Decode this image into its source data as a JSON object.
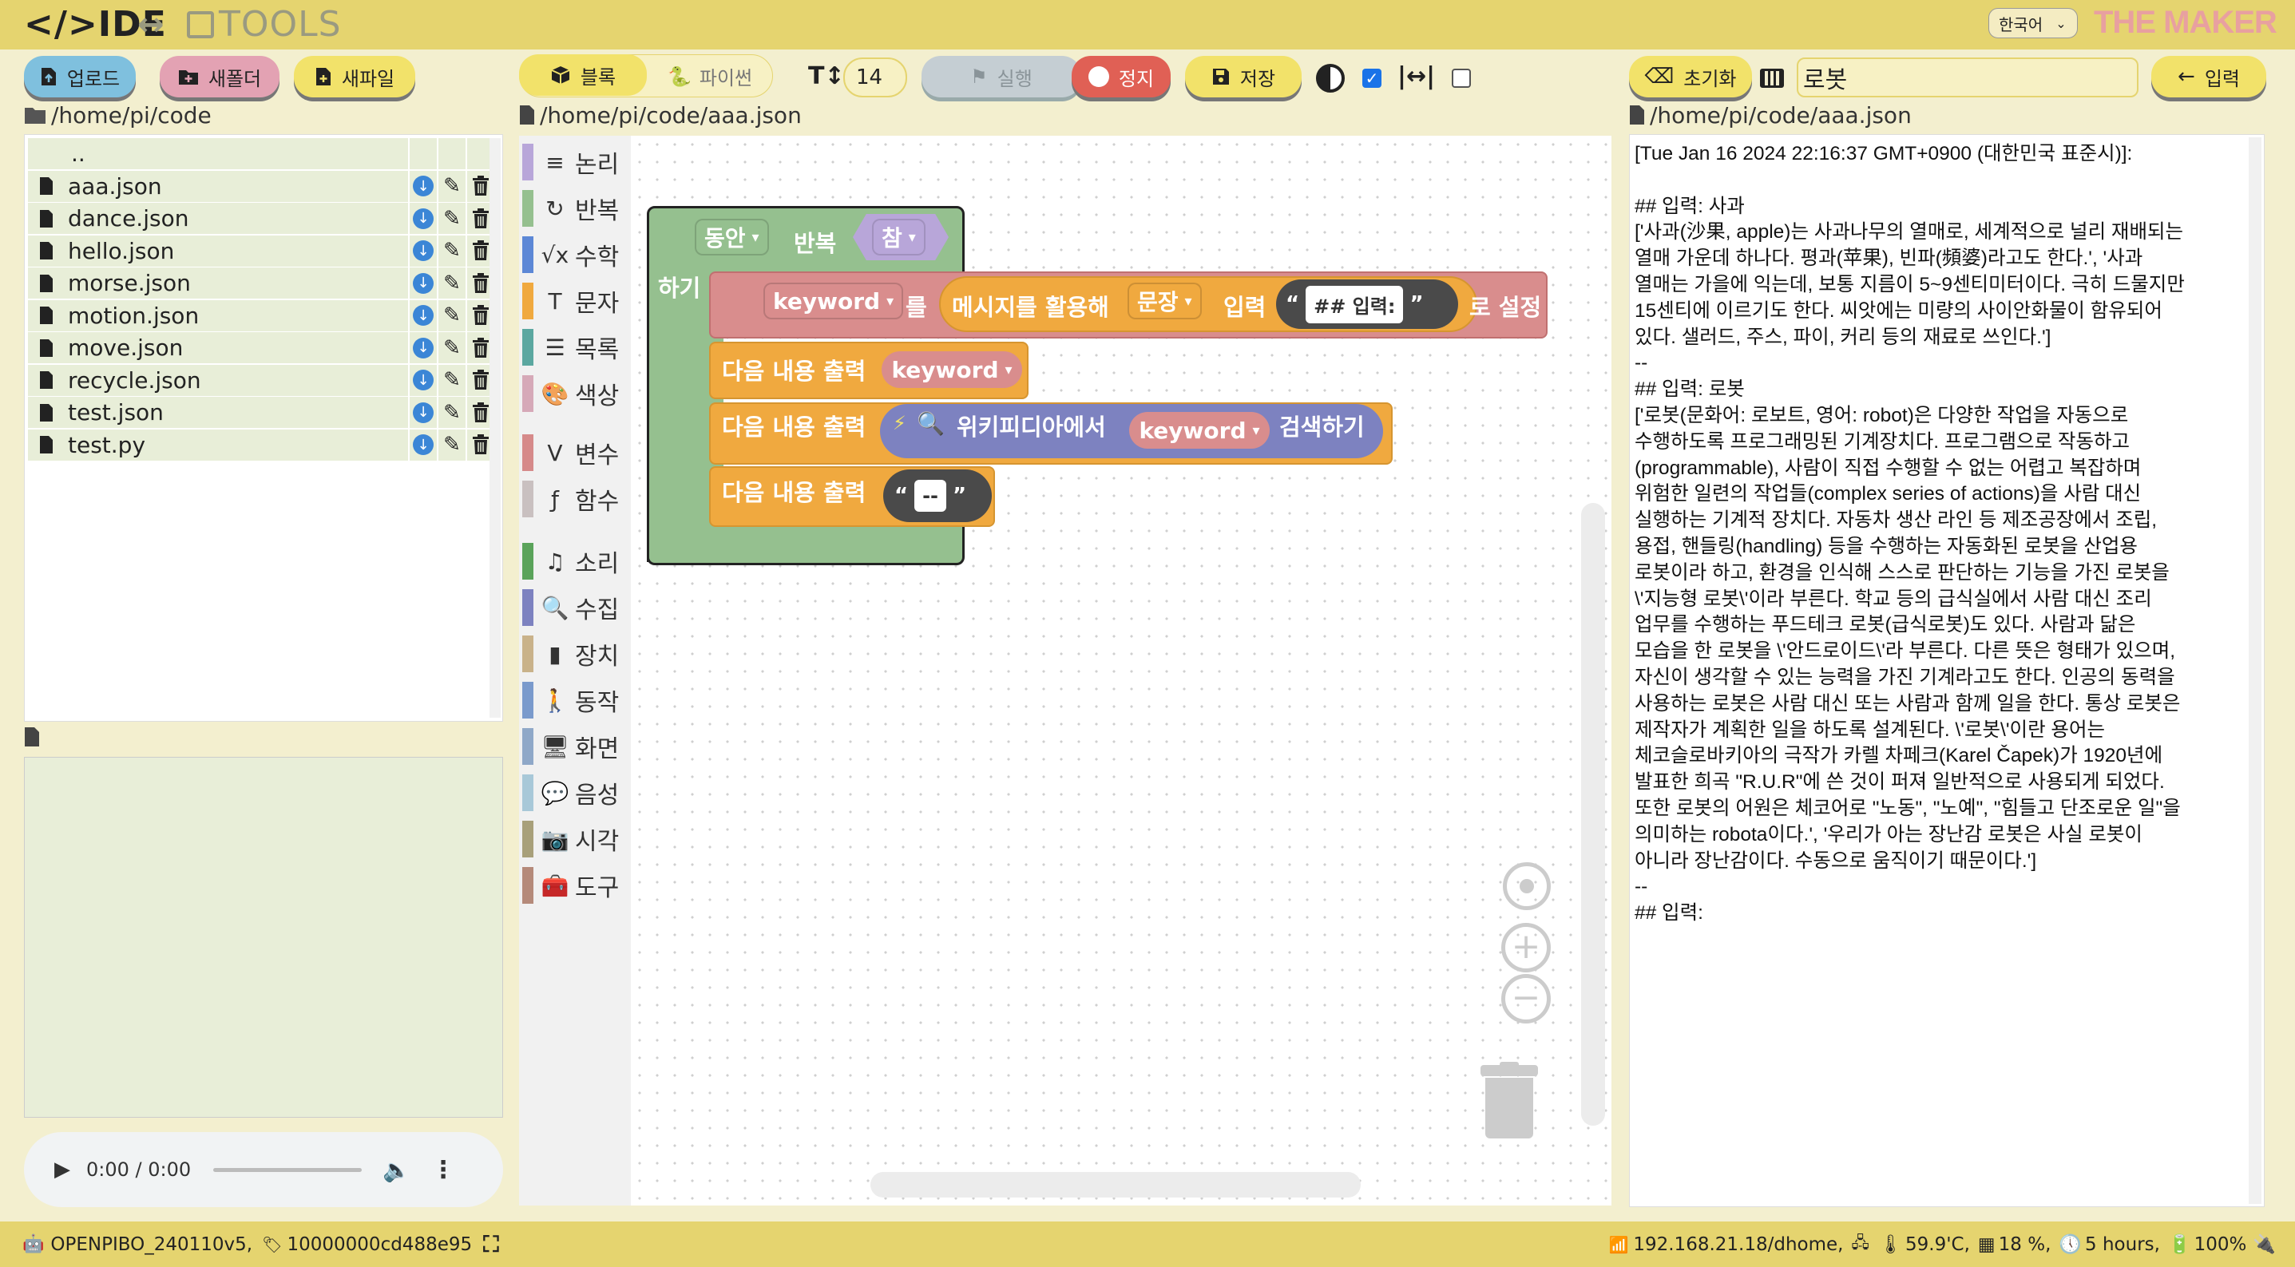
{
  "header": {
    "logo_ide": "</>IDE",
    "logo_arrow": "↔",
    "logo_tools": "TOOLS",
    "language": "한국어",
    "brand": "THE MAKER"
  },
  "left": {
    "buttons": {
      "upload": "업로드",
      "new_folder": "새폴더",
      "new_file": "새파일"
    },
    "path": "/home/pi/code",
    "files": [
      {
        "name": ".."
      },
      {
        "name": "aaa.json"
      },
      {
        "name": "dance.json"
      },
      {
        "name": "hello.json"
      },
      {
        "name": "morse.json"
      },
      {
        "name": "motion.json"
      },
      {
        "name": "move.json"
      },
      {
        "name": "recycle.json"
      },
      {
        "name": "test.json"
      },
      {
        "name": "test.py"
      }
    ],
    "audio_time": "0:00 / 0:00"
  },
  "editor": {
    "tab_block": "블록",
    "tab_python": "파이썬",
    "font_size": "14",
    "run": "실행",
    "stop": "정지",
    "save": "저장",
    "path": "/home/pi/code/aaa.json",
    "categories": [
      {
        "label": "논리",
        "color": "#b8a6d9",
        "icon": "≡"
      },
      {
        "label": "반복",
        "color": "#95c08f",
        "icon": "↻"
      },
      {
        "label": "수학",
        "color": "#5c87d6",
        "icon": "√x"
      },
      {
        "label": "문자",
        "color": "#f0a93f",
        "icon": "T"
      },
      {
        "label": "목록",
        "color": "#5ba7a0",
        "icon": "☰"
      },
      {
        "label": "색상",
        "color": "#d6a9b8",
        "icon": "🎨"
      },
      {
        "label": "변수",
        "color": "#d68a8a",
        "icon": "V"
      },
      {
        "label": "함수",
        "color": "#c9c0c0",
        "icon": "ƒ"
      },
      {
        "label": "소리",
        "color": "#5aa35a",
        "icon": "♫"
      },
      {
        "label": "수집",
        "color": "#7d82c0",
        "icon": "🔍"
      },
      {
        "label": "장치",
        "color": "#c9b28a",
        "icon": "▮"
      },
      {
        "label": "동작",
        "color": "#7a9acc",
        "icon": "🚶"
      },
      {
        "label": "화면",
        "color": "#8fa8c8",
        "icon": "🖥"
      },
      {
        "label": "음성",
        "color": "#a8c8d8",
        "icon": "💬"
      },
      {
        "label": "시각",
        "color": "#a8a07a",
        "icon": "📷"
      },
      {
        "label": "도구",
        "color": "#b58a7a",
        "icon": "🧰"
      }
    ],
    "blocks": {
      "while_label": "동안",
      "repeat_label": "반복",
      "cond_value": "참",
      "do_label": "하기",
      "var_keyword": "keyword",
      "set_obj": "를",
      "prompt_prefix": "메시지를 활용해",
      "prompt_type": "문장",
      "prompt_input": "입력",
      "prompt_text": "## 입력:",
      "set_suffix": "로 설정",
      "print_label": "다음 내용 출력",
      "wiki_label": "위키피디아에서",
      "wiki_search": "검색하기",
      "dash_text": "--"
    }
  },
  "right": {
    "reset": "초기화",
    "input_value": "로봇",
    "submit": "입력",
    "path": "/home/pi/code/aaa.json",
    "output_lines": [
      "[Tue Jan 16 2024 22:16:37 GMT+0900 (대한민국 표준시)]:",
      "",
      "## 입력: 사과",
      "['사과(沙果, apple)는 사과나무의 열매로, 세계적으로 널리 재배되는",
      "열매 가운데 하나다. 평과(苹果), 빈파(頻婆)라고도 한다.', '사과",
      "열매는 가을에 익는데, 보통 지름이 5~9센티미터이다. 극히 드물지만",
      "15센티에 이르기도 한다. 씨앗에는 미량의 사이안화물이 함유되어",
      "있다. 샐러드, 주스, 파이, 커리 등의 재료로 쓰인다.']",
      "--",
      "## 입력: 로봇",
      "['로봇(문화어: 로보트, 영어: robot)은 다양한 작업을 자동으로",
      "수행하도록 프로그래밍된 기계장치다. 프로그램으로 작동하고",
      "(programmable), 사람이 직접 수행할 수 없는 어렵고 복잡하며",
      "위험한 일련의 작업들(complex series of actions)을 사람 대신",
      "실행하는 기계적 장치다. 자동차 생산 라인 등 제조공장에서 조립,",
      "용접, 핸들링(handling) 등을 수행하는 자동화된 로봇을 산업용",
      "로봇이라 하고, 환경을 인식해 스스로 판단하는 기능을 가진 로봇을",
      "\\'지능형 로봇\\'이라 부른다. 학교 등의 급식실에서 사람 대신 조리",
      "업무를 수행하는 푸드테크 로봇(급식로봇)도 있다. 사람과 닮은",
      "모습을 한 로봇을 \\'안드로이드\\'라 부른다. 다른 뜻은 형태가 있으며,",
      "자신이 생각할 수 있는 능력을 가진 기계라고도 한다. 인공의 동력을",
      "사용하는 로봇은 사람 대신 또는 사람과 함께 일을 한다. 통상 로봇은",
      "제작자가 계획한 일을 하도록 설계된다. \\'로봇\\'이란 용어는",
      "체코슬로바키아의 극작가 카렐 차페크(Karel Čapek)가 1920년에",
      "발표한 희곡 \"R.U.R\"에 쓴 것이 퍼져 일반적으로 사용되게 되었다.",
      "또한 로봇의 어원은 체코어로 \"노동\", \"노예\", \"힘들고 단조로운 일\"을",
      "의미하는 robota이다.', '우리가 아는 장난감 로봇은 사실 로봇이",
      "아니라 장난감이다. 수동으로 움직이기 때문이다.']",
      "--",
      "## 입력:"
    ]
  },
  "status": {
    "device": "OPENPIBO_240110v5,",
    "serial": "10000000cd488e95",
    "network": "192.168.21.18/dhome,",
    "temp": "59.9'C,",
    "mem": "18 %,",
    "uptime": "5 hours,",
    "battery": "100%"
  },
  "colors": {
    "header_bg": "#e5d46f",
    "page_bg": "#f3efcf",
    "loop_green": "#95c08f",
    "var_red": "#d98d8d",
    "text_orange": "#f0a93f",
    "wiki_purple": "#7d82c0"
  }
}
